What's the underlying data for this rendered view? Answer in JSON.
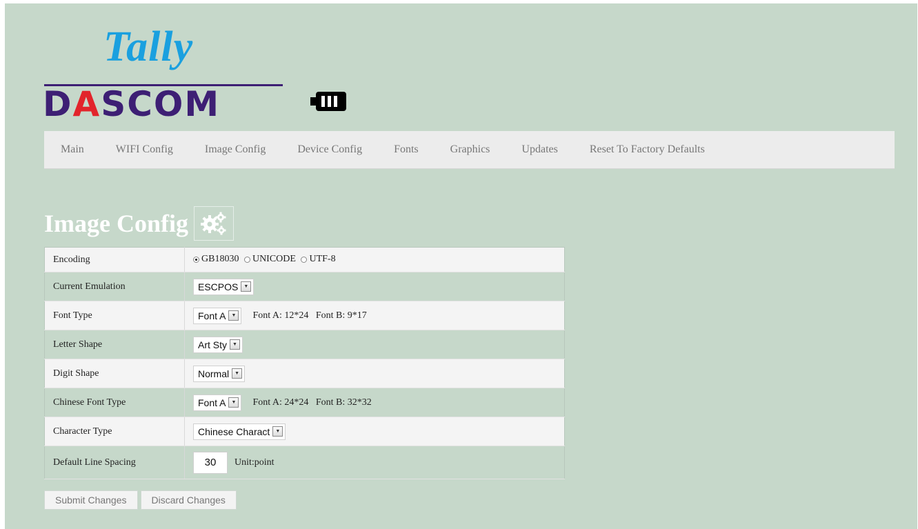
{
  "brand": {
    "tally": "Tally",
    "dascom_pre": "D",
    "dascom_a": "A",
    "dascom_post": "SCOM",
    "tally_color": "#1aa0df",
    "dascom_color": "#3d1f74",
    "accent_color": "#e2242b"
  },
  "nav": {
    "items": [
      {
        "label": "Main"
      },
      {
        "label": "WIFI Config"
      },
      {
        "label": "Image Config"
      },
      {
        "label": "Device Config"
      },
      {
        "label": "Fonts"
      },
      {
        "label": "Graphics"
      },
      {
        "label": "Updates"
      },
      {
        "label": "Reset To Factory Defaults"
      }
    ]
  },
  "page": {
    "title": "Image Config",
    "title_icon": "gears-icon"
  },
  "config": {
    "encoding": {
      "label": "Encoding",
      "options": [
        "GB18030",
        "UNICODE",
        "UTF-8"
      ],
      "selected": "GB18030"
    },
    "emulation": {
      "label": "Current Emulation",
      "value": "ESCPOS"
    },
    "font_type": {
      "label": "Font Type",
      "value": "Font A",
      "note": "Font A: 12*24   Font B: 9*17"
    },
    "letter_shape": {
      "label": "Letter Shape",
      "value": "Art Sty"
    },
    "digit_shape": {
      "label": "Digit Shape",
      "value": "Normal"
    },
    "chinese_font_type": {
      "label": "Chinese Font Type",
      "value": "Font A",
      "note": "Font A: 24*24   Font B: 32*32"
    },
    "character_type": {
      "label": "Character Type",
      "value": "Chinese Charact"
    },
    "line_spacing": {
      "label": "Default Line Spacing",
      "value": "30",
      "unit": "Unit:point"
    }
  },
  "actions": {
    "submit": "Submit Changes",
    "discard": "Discard Changes"
  },
  "colors": {
    "background": "#c6d8ca",
    "nav_background": "#ececec",
    "row_light": "#f4f4f4"
  }
}
